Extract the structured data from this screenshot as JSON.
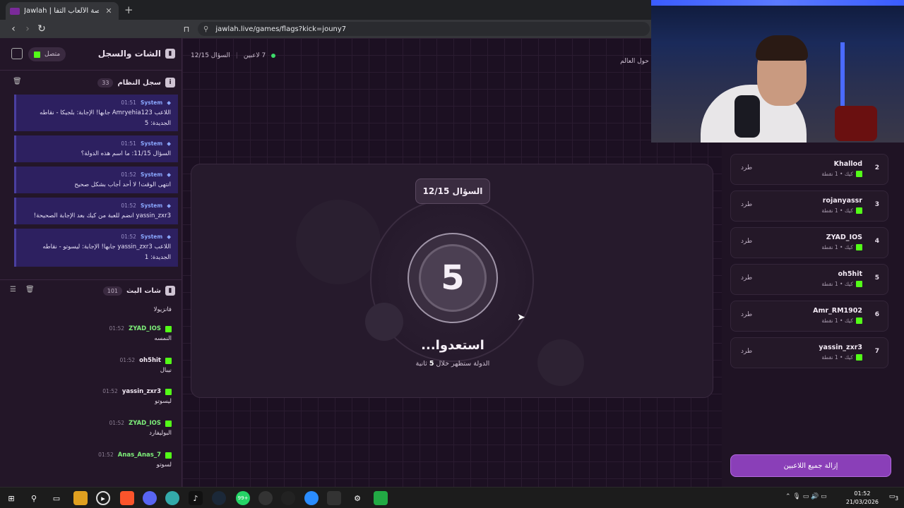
{
  "browser": {
    "tab_title": "Jawlah | جولة - منصة الألعاب التفا",
    "url": "jawlah.live/games/flags?kick=jouny7"
  },
  "sidebar": {
    "title": "الشات والسجل",
    "status": "متصل",
    "system_log": {
      "title": "سجل النظام",
      "count": "33",
      "messages": [
        {
          "sender": "System",
          "time": "01:51",
          "text": "اللاعب Amryehia123 جابها! الإجابة: بلجيكا - نقاطه الجديدة: 5"
        },
        {
          "sender": "System",
          "time": "01:51",
          "text": "السؤال 11/15: ما اسم هذه الدولة؟"
        },
        {
          "sender": "System",
          "time": "01:52",
          "text": "انتهى الوقت! لا أحد أجاب بشكل صحيح"
        },
        {
          "sender": "System",
          "time": "01:52",
          "text": "yassin_zxr3 انضم للعبة من كيك بعد الإجابة الصحيحة!"
        },
        {
          "sender": "System",
          "time": "01:52",
          "text": "اللاعب yassin_zxr3 جابها! الإجابة: ليسوتو - نقاطه الجديدة: 1"
        }
      ]
    },
    "stream_chat": {
      "title": "شات البث",
      "count": "101",
      "messages": [
        {
          "user": "",
          "time": "",
          "text": "فانزيولا"
        },
        {
          "user": "ZYAD_IOS",
          "time": "01:52",
          "text": "النمسه"
        },
        {
          "user": "oh5hit",
          "time": "01:52",
          "text": "نيبال"
        },
        {
          "user": "yassin_zxr3",
          "time": "01:52",
          "text": "ليسوتو"
        },
        {
          "user": "ZYAD_IOS",
          "time": "01:52",
          "text": "البوليفارد"
        },
        {
          "user": "Anas_Anas_7",
          "time": "01:52",
          "text": "لسوتو"
        }
      ]
    }
  },
  "main": {
    "players_count": "7 لاعبين",
    "question_progress": "السؤال 12/15",
    "subtitle": "اختبار معرفتك بأعلام الدول حول العالم",
    "question_badge": "السؤال 12/15",
    "countdown": "5",
    "ready_text": "استعدوا...",
    "ready_sub_prefix": "الدولة ستظهر خلال",
    "ready_sub_num": "5",
    "ready_sub_suffix": "ثانية"
  },
  "players": {
    "kick_label": "طرد",
    "rows": [
      {
        "rank": "2",
        "name": "Khallod",
        "stat": "كيك • 1 نقطة"
      },
      {
        "rank": "3",
        "name": "rojanyassr",
        "stat": "كيك • 1 نقطة"
      },
      {
        "rank": "4",
        "name": "ZYAD_IOS",
        "stat": "كيك • 1 نقطة"
      },
      {
        "rank": "5",
        "name": "oh5hit",
        "stat": "كيك • 1 نقطة"
      },
      {
        "rank": "6",
        "name": "Amr_RM1902",
        "stat": "كيك • 1 نقطة"
      },
      {
        "rank": "7",
        "name": "yassin_zxr3",
        "stat": "كيك • 1 نقطة"
      }
    ],
    "remove_all": "إزالة جميع اللاعبين"
  },
  "taskbar": {
    "time": "01:52",
    "date": "21/03/2026",
    "badge": "99+",
    "notif": "3"
  },
  "colors": {
    "accent": "#8a3fb8",
    "kick_green": "#53fc18",
    "system_bg": "#2d2060"
  }
}
